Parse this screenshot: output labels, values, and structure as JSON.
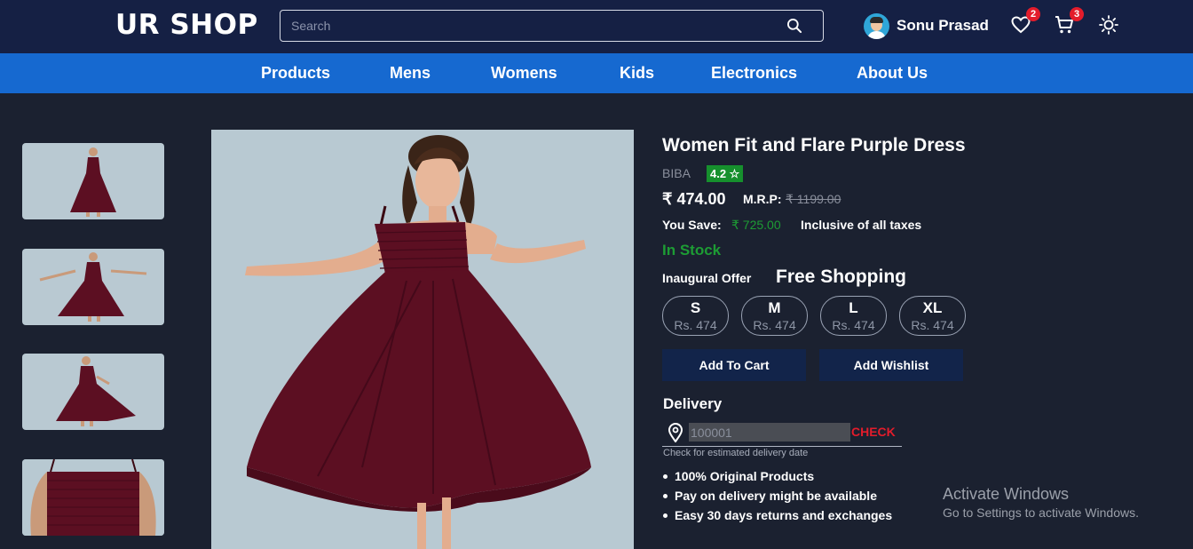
{
  "header": {
    "logo": "UR SHOP",
    "search_placeholder": "Search",
    "user_name": "Sonu Prasad",
    "wishlist_count": "2",
    "cart_count": "3"
  },
  "nav": {
    "items": [
      "Products",
      "Mens",
      "Womens",
      "Kids",
      "Electronics",
      "About Us"
    ]
  },
  "product": {
    "title": "Women Fit and Flare Purple Dress",
    "brand": "BIBA",
    "rating": "4.2 ☆",
    "price": "₹ 474.00",
    "mrp_label": "M.R.P:",
    "mrp": "₹ 1199.00",
    "save_label": "You Save:",
    "save_value": "₹ 725.00",
    "tax_note": "Inclusive of all taxes",
    "stock": "In Stock",
    "offer_label": "Inaugural Offer",
    "offer_value": "Free Shopping",
    "sizes": [
      {
        "size": "S",
        "price": "Rs. 474"
      },
      {
        "size": "M",
        "price": "Rs. 474"
      },
      {
        "size": "L",
        "price": "Rs. 474"
      },
      {
        "size": "XL",
        "price": "Rs. 474"
      }
    ],
    "add_to_cart": "Add To Cart",
    "add_wishlist": "Add Wishlist",
    "dress_color": "#5c0f22"
  },
  "delivery": {
    "heading": "Delivery",
    "pincode_placeholder": "100001",
    "check_label": "CHECK",
    "hint": "Check for estimated delivery date",
    "features": [
      "100% Original Products",
      "Pay on delivery might be available",
      "Easy 30 days returns and exchanges"
    ]
  },
  "watermark": {
    "title": "Activate Windows",
    "subtitle": "Go to Settings to activate Windows."
  },
  "colors": {
    "header_bg": "#152044",
    "nav_bg": "#1669d0",
    "page_bg": "#1b2130",
    "in_stock": "#1d9c34",
    "badge": "#e31c2b"
  }
}
